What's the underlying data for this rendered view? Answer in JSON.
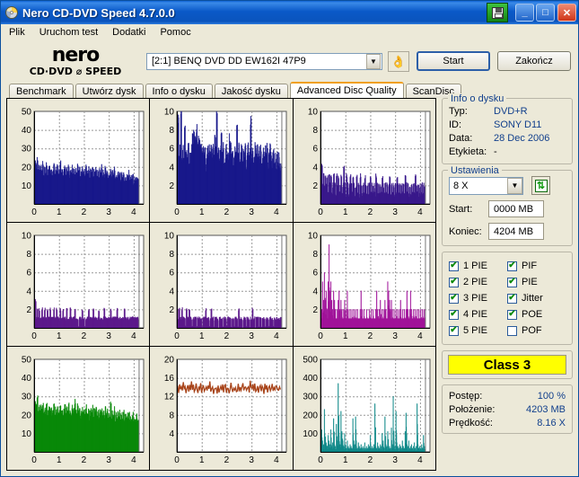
{
  "window": {
    "title": "Nero CD-DVD Speed 4.7.0.0",
    "icon": "disc-icon",
    "save_icon": "floppy-save-icon",
    "minimize": "_",
    "maximize": "□",
    "close": "✕"
  },
  "menu": [
    "Plik",
    "Uruchom test",
    "Dodatki",
    "Pomoc"
  ],
  "logo": {
    "line1": "nero",
    "line2": "CD·DVD ⌀ SPEED"
  },
  "toolbar": {
    "drive_value": "[2:1]   BENQ DVD DD EW162I 47P9",
    "drive_arrow": "▼",
    "eject_icon": "hand-disc-icon",
    "start_label": "Start",
    "exit_label": "Zakończ"
  },
  "tabs": [
    {
      "label": "Benchmark",
      "active": false
    },
    {
      "label": "Utwórz dysk",
      "active": false
    },
    {
      "label": "Info o dysku",
      "active": false
    },
    {
      "label": "Jakość dysku",
      "active": false
    },
    {
      "label": "Advanced Disc Quality",
      "active": true
    },
    {
      "label": "ScanDisc",
      "active": false
    }
  ],
  "disc_info": {
    "legend": "Info o dysku",
    "rows": [
      {
        "key": "Typ:",
        "value": "DVD+R"
      },
      {
        "key": "ID:",
        "value": "SONY D11"
      },
      {
        "key": "Data:",
        "value": "28 Dec 2006"
      },
      {
        "key": "Etykieta:",
        "value": "-"
      }
    ]
  },
  "settings": {
    "legend": "Ustawienia",
    "speed": "8 X",
    "speed_arrow": "▼",
    "refresh_icon": "refresh-arrows-icon",
    "start_label": "Start:",
    "start_value": "0000 MB",
    "end_label": "Koniec:",
    "end_value": "4204 MB"
  },
  "checkboxes": [
    {
      "label": "1 PIE",
      "checked": true
    },
    {
      "label": "PIF",
      "checked": true
    },
    {
      "label": "2 PIE",
      "checked": true
    },
    {
      "label": "PIE",
      "checked": true
    },
    {
      "label": "3 PIE",
      "checked": true
    },
    {
      "label": "Jitter",
      "checked": true
    },
    {
      "label": "4 PIE",
      "checked": true
    },
    {
      "label": "POE",
      "checked": true
    },
    {
      "label": "5 PIE",
      "checked": true
    },
    {
      "label": "POF",
      "checked": false
    }
  ],
  "check_mark": "✔",
  "class_result": "Class 3",
  "status": [
    {
      "key": "Postęp:",
      "value": "100 %"
    },
    {
      "key": "Położenie:",
      "value": "4203 MB"
    },
    {
      "key": "Prędkość:",
      "value": "8.16 X"
    }
  ],
  "colors": {
    "pie_1_3": "#1a1a8c",
    "pie_4_5": "#5c1a8c",
    "pif": "#a0149b",
    "pie_total": "#0a8a0a",
    "jitter": "#a8441a",
    "poe": "#118a8a",
    "class_bg": "#ffff00",
    "accent": "#113f8c",
    "tab_active": "#f0a020"
  },
  "chart_data": [
    {
      "id": "chart-1-pie",
      "type": "bar",
      "title": "1 PIE",
      "color": "#1a1a8c",
      "xlabel": "",
      "ylabel": "",
      "xticks": [
        0,
        1,
        2,
        3,
        4
      ],
      "yticks": [
        10,
        20,
        30,
        40,
        50
      ],
      "xlim": [
        0,
        4.4
      ],
      "ylim": [
        0,
        50
      ],
      "grid": true,
      "x_end": 4.2,
      "mean": 16,
      "band": [
        11,
        24
      ],
      "values": [
        19,
        22,
        20,
        24,
        18,
        21,
        17,
        20,
        18,
        22,
        16,
        19,
        17,
        21,
        15,
        18,
        20,
        17,
        19,
        16,
        18,
        21,
        15,
        19,
        17,
        20,
        16,
        18,
        22,
        17,
        19,
        15,
        18,
        20,
        16,
        19,
        17,
        21,
        15,
        18,
        16,
        20,
        17,
        19,
        15,
        18,
        16,
        21,
        17,
        19,
        14,
        17,
        19,
        16,
        18,
        15,
        20,
        17,
        16,
        19,
        14,
        18,
        16,
        20,
        15,
        18,
        17,
        19,
        14,
        17,
        15,
        18,
        16,
        20,
        14,
        17,
        15,
        19,
        16,
        18,
        13,
        16,
        15,
        18,
        14,
        17,
        16,
        19,
        13,
        16,
        14,
        17,
        15,
        18,
        13,
        16,
        14,
        17,
        12,
        15,
        13,
        16,
        14,
        17,
        12,
        15,
        13,
        16,
        11,
        14,
        12,
        15,
        13,
        12
      ]
    },
    {
      "id": "chart-2-pie",
      "type": "bar",
      "title": "2 PIE",
      "color": "#1a1a8c",
      "xticks": [
        0,
        1,
        2,
        3,
        4
      ],
      "yticks": [
        2,
        4,
        6,
        8,
        10
      ],
      "xlim": [
        0,
        4.4
      ],
      "ylim": [
        0,
        10
      ],
      "grid": true,
      "x_end": 4.2,
      "mean": 5.5,
      "band": [
        4,
        10
      ],
      "values": [
        6,
        9,
        5,
        6,
        10,
        5,
        6,
        5,
        8,
        5,
        6,
        5,
        6,
        4,
        6,
        5,
        7,
        7,
        8,
        7,
        7,
        8,
        6,
        7,
        7,
        6,
        6,
        5,
        6,
        5,
        6,
        4,
        5,
        6,
        5,
        6,
        5,
        6,
        5,
        6,
        5,
        7,
        6,
        10,
        5,
        6,
        5,
        6,
        8,
        5,
        6,
        4,
        5,
        6,
        5,
        6,
        5,
        7,
        6,
        5,
        6,
        4,
        5,
        6,
        5,
        8,
        5,
        6,
        4,
        5,
        6,
        5,
        6,
        5,
        6,
        4,
        5,
        6,
        5,
        6,
        9,
        5,
        6,
        4,
        5,
        6,
        5,
        6,
        5,
        6,
        5,
        6,
        4,
        5,
        6,
        5,
        6,
        5,
        6,
        4,
        5,
        6,
        5,
        4,
        5,
        6,
        4,
        5,
        4,
        5,
        4,
        5,
        4,
        4
      ]
    },
    {
      "id": "chart-3-pie",
      "type": "bar",
      "title": "3 PIE",
      "color": "#3b1a8c",
      "xticks": [
        0,
        1,
        2,
        3,
        4
      ],
      "yticks": [
        2,
        4,
        6,
        8,
        10
      ],
      "xlim": [
        0,
        4.4
      ],
      "ylim": [
        0,
        10
      ],
      "grid": true,
      "x_end": 4.2,
      "mean": 1.8,
      "band": [
        1,
        4
      ],
      "values": [
        3,
        4,
        2,
        3,
        2,
        3,
        2,
        3,
        1,
        3,
        2,
        3,
        1,
        2,
        3,
        2,
        1,
        3,
        2,
        3,
        1,
        2,
        3,
        1,
        2,
        4,
        2,
        1,
        3,
        2,
        1,
        2,
        3,
        2,
        1,
        3,
        2,
        1,
        2,
        3,
        1,
        2,
        1,
        3,
        2,
        1,
        2,
        1,
        3,
        2,
        1,
        2,
        1,
        2,
        3,
        1,
        2,
        1,
        2,
        1,
        3,
        2,
        1,
        2,
        1,
        2,
        1,
        3,
        2,
        1,
        2,
        1,
        2,
        1,
        2,
        3,
        1,
        2,
        1,
        2,
        1,
        2,
        1,
        3,
        2,
        1,
        2,
        1,
        2,
        1,
        2,
        1,
        3,
        2,
        1,
        2,
        1,
        2,
        1,
        2,
        1,
        2,
        1,
        3,
        2,
        1,
        2,
        1,
        2,
        1,
        2,
        1,
        2,
        2
      ]
    },
    {
      "id": "chart-4-pie",
      "type": "bar",
      "title": "4 PIE",
      "color": "#5c1a8c",
      "xticks": [
        0,
        1,
        2,
        3,
        4
      ],
      "yticks": [
        2,
        4,
        6,
        8,
        10
      ],
      "xlim": [
        0,
        4.4
      ],
      "ylim": [
        0,
        10
      ],
      "grid": true,
      "x_end": 4.2,
      "mean": 1.1,
      "band": [
        1,
        3
      ],
      "values": [
        2,
        3,
        1,
        2,
        1,
        2,
        1,
        1,
        2,
        1,
        1,
        2,
        1,
        1,
        2,
        1,
        1,
        2,
        1,
        1,
        1,
        2,
        1,
        1,
        2,
        1,
        1,
        1,
        2,
        1,
        1,
        2,
        1,
        1,
        1,
        2,
        1,
        1,
        1,
        2,
        1,
        1,
        1,
        1,
        2,
        1,
        1,
        1,
        0,
        1,
        1,
        1,
        2,
        1,
        1,
        0,
        1,
        1,
        1,
        2,
        1,
        1,
        1,
        1,
        2,
        1,
        1,
        1,
        1,
        1,
        2,
        1,
        1,
        1,
        1,
        1,
        2,
        1,
        1,
        1,
        1,
        1,
        1,
        2,
        1,
        1,
        1,
        1,
        1,
        1,
        2,
        1,
        1,
        1,
        1,
        1,
        1,
        1,
        2,
        1,
        1,
        1,
        1,
        1,
        1,
        1,
        1,
        1,
        1,
        1,
        1,
        1,
        1,
        1
      ]
    },
    {
      "id": "chart-5-pie",
      "type": "bar",
      "title": "5 PIE",
      "color": "#5c1a8c",
      "xticks": [
        0,
        1,
        2,
        3,
        4
      ],
      "yticks": [
        2,
        4,
        6,
        8,
        10
      ],
      "xlim": [
        0,
        4.4
      ],
      "ylim": [
        0,
        10
      ],
      "grid": true,
      "x_end": 4.2,
      "mean": 0.8,
      "band": [
        0,
        2
      ],
      "values": [
        2,
        1,
        2,
        1,
        1,
        2,
        1,
        1,
        1,
        0,
        2,
        1,
        1,
        2,
        1,
        1,
        0,
        1,
        1,
        1,
        1,
        0,
        1,
        1,
        1,
        1,
        1,
        0,
        1,
        1,
        1,
        2,
        1,
        1,
        1,
        0,
        1,
        2,
        1,
        1,
        0,
        1,
        1,
        1,
        1,
        0,
        1,
        1,
        1,
        1,
        0,
        1,
        1,
        1,
        0,
        1,
        1,
        1,
        1,
        0,
        1,
        1,
        0,
        1,
        1,
        1,
        0,
        2,
        1,
        1,
        1,
        0,
        1,
        1,
        1,
        0,
        1,
        1,
        1,
        0,
        1,
        1,
        2,
        1,
        1,
        0,
        1,
        1,
        1,
        0,
        1,
        1,
        0,
        1,
        1,
        1,
        0,
        1,
        1,
        1,
        0,
        1,
        1,
        1,
        1,
        0,
        1,
        1,
        1,
        1,
        1,
        1,
        1,
        1
      ]
    },
    {
      "id": "chart-pif",
      "type": "bar",
      "title": "PIF",
      "color": "#a0149b",
      "xticks": [
        0,
        1,
        2,
        3,
        4
      ],
      "yticks": [
        2,
        4,
        6,
        8,
        10
      ],
      "xlim": [
        0,
        4.4
      ],
      "ylim": [
        0,
        10
      ],
      "grid": true,
      "x_end": 4.2,
      "mean": 2.1,
      "band": [
        1,
        9
      ],
      "values": [
        2,
        2,
        5,
        3,
        6,
        3,
        4,
        2,
        5,
        9,
        4,
        5,
        3,
        2,
        4,
        3,
        2,
        1,
        2,
        3,
        4,
        2,
        3,
        2,
        1,
        2,
        3,
        1,
        2,
        4,
        2,
        1,
        2,
        1,
        2,
        1,
        2,
        1,
        2,
        1,
        2,
        1,
        1,
        2,
        4,
        2,
        1,
        2,
        1,
        1,
        2,
        1,
        1,
        2,
        1,
        2,
        1,
        2,
        1,
        1,
        2,
        4,
        2,
        1,
        2,
        3,
        1,
        2,
        1,
        2,
        3,
        2,
        1,
        5,
        4,
        3,
        2,
        3,
        2,
        1,
        2,
        1,
        2,
        1,
        2,
        1,
        2,
        3,
        1,
        2,
        1,
        2,
        1,
        2,
        4,
        2,
        1,
        2,
        4,
        2,
        1,
        2,
        1,
        2,
        1,
        2,
        1,
        2,
        1,
        2,
        1,
        2,
        1,
        2
      ]
    },
    {
      "id": "chart-pie-total",
      "type": "bar",
      "title": "PIE",
      "color": "#0a8a0a",
      "xticks": [
        0,
        1,
        2,
        3,
        4
      ],
      "yticks": [
        10,
        20,
        30,
        40,
        50
      ],
      "xlim": [
        0,
        4.4
      ],
      "ylim": [
        0,
        50
      ],
      "grid": true,
      "x_end": 4.2,
      "mean": 20,
      "band": [
        14,
        29
      ],
      "values": [
        23,
        26,
        24,
        29,
        22,
        25,
        21,
        24,
        22,
        26,
        20,
        23,
        21,
        25,
        19,
        22,
        24,
        21,
        23,
        20,
        22,
        25,
        19,
        23,
        21,
        24,
        20,
        22,
        26,
        21,
        23,
        19,
        22,
        24,
        20,
        23,
        21,
        25,
        19,
        22,
        20,
        24,
        21,
        23,
        27,
        22,
        20,
        25,
        21,
        23,
        18,
        21,
        23,
        20,
        22,
        19,
        24,
        21,
        20,
        23,
        18,
        22,
        20,
        24,
        19,
        22,
        21,
        23,
        18,
        21,
        19,
        22,
        20,
        24,
        18,
        21,
        19,
        23,
        20,
        22,
        17,
        20,
        19,
        26,
        18,
        21,
        20,
        23,
        17,
        20,
        18,
        21,
        19,
        22,
        17,
        20,
        18,
        21,
        16,
        19,
        17,
        20,
        18,
        21,
        16,
        19,
        17,
        20,
        15,
        18,
        16,
        19,
        17,
        16
      ]
    },
    {
      "id": "chart-jitter",
      "type": "line",
      "title": "Jitter",
      "color": "#a8441a",
      "xticks": [
        0,
        1,
        2,
        3,
        4
      ],
      "yticks": [
        4,
        8,
        12,
        16,
        20
      ],
      "xlim": [
        0,
        4.4
      ],
      "ylim": [
        0,
        20
      ],
      "grid": true,
      "x_end": 4.2,
      "mean": 13.6,
      "band": [
        12,
        16
      ],
      "values": [
        13.8,
        14.5,
        13.2,
        15.0,
        13.5,
        14.2,
        12.8,
        14.8,
        13.4,
        14.0,
        12.6,
        13.9,
        14.6,
        13.1,
        14.3,
        13.0,
        14.9,
        13.6,
        14.1,
        12.9,
        13.7,
        14.4,
        13.3,
        12.7,
        14.0,
        13.5,
        14.7,
        13.2,
        13.8,
        14.2,
        12.8,
        13.6,
        14.5,
        13.1,
        14.0,
        13.4,
        14.8,
        13.0,
        13.9,
        14.3,
        12.9,
        13.7,
        14.1,
        13.5,
        12.6,
        14.6,
        13.3,
        14.0,
        13.8,
        12.8,
        14.4,
        13.2,
        13.9,
        14.7,
        13.1,
        13.6,
        14.2,
        12.7,
        13.8,
        14.5,
        13.4,
        12.9,
        14.0,
        13.7,
        14.3,
        13.0,
        13.5,
        14.8,
        13.2,
        14.1,
        12.8,
        13.9,
        14.6,
        13.3,
        13.7,
        14.4,
        12.9,
        13.8,
        14.0,
        13.1,
        15.5,
        14.2,
        13.6,
        14.9,
        13.4,
        14.5,
        13.0,
        13.8,
        14.3,
        12.8,
        13.9,
        14.6,
        13.2,
        14.0,
        13.5,
        12.7,
        14.4,
        13.7,
        14.1,
        13.3,
        13.9,
        14.7,
        13.0,
        13.6,
        14.2,
        12.9,
        14.0,
        13.4,
        13.8,
        14.5,
        13.1,
        13.7,
        14.3,
        13.5
      ]
    },
    {
      "id": "chart-poe",
      "type": "bar",
      "title": "POE",
      "color": "#118a8a",
      "xticks": [
        0,
        1,
        2,
        3,
        4
      ],
      "yticks": [
        100,
        200,
        300,
        400,
        500
      ],
      "xlim": [
        0,
        4.4
      ],
      "ylim": [
        0,
        500
      ],
      "grid": true,
      "x_end": 4.2,
      "mean": 40,
      "band": [
        0,
        380
      ],
      "values": [
        30,
        120,
        60,
        40,
        230,
        80,
        50,
        30,
        90,
        60,
        40,
        120,
        30,
        50,
        180,
        40,
        30,
        150,
        60,
        370,
        90,
        40,
        220,
        110,
        60,
        30,
        100,
        40,
        20,
        60,
        30,
        20,
        40,
        30,
        20,
        180,
        60,
        40,
        190,
        30,
        20,
        50,
        30,
        20,
        40,
        20,
        30,
        20,
        50,
        20,
        30,
        20,
        40,
        30,
        90,
        20,
        30,
        20,
        40,
        260,
        30,
        20,
        50,
        30,
        20,
        40,
        30,
        100,
        60,
        20,
        190,
        40,
        30,
        110,
        20,
        30,
        20,
        130,
        40,
        300,
        60,
        30,
        220,
        50,
        30,
        20,
        40,
        30,
        20,
        60,
        30,
        20,
        110,
        210,
        40,
        30,
        60,
        20,
        30,
        40,
        20,
        30,
        50,
        20,
        30,
        260,
        40,
        20,
        30,
        20,
        40,
        20,
        90,
        30
      ]
    }
  ]
}
